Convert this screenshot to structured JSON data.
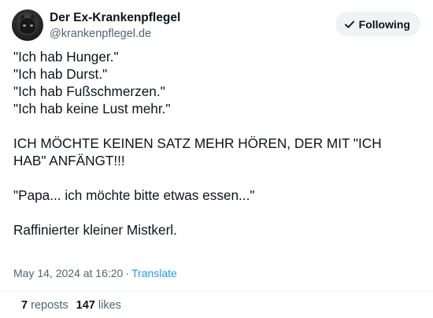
{
  "author": {
    "display_name": "Der Ex-Krankenpflegel",
    "handle": "@krankenpflegel.de"
  },
  "follow_button": {
    "label": "Following"
  },
  "post": {
    "text": "\"Ich hab Hunger.\"\n\"Ich hab Durst.\"\n\"Ich hab Fußschmerzen.\"\n\"Ich hab keine Lust mehr.\"\n\nICH MÖCHTE KEINEN SATZ MEHR HÖREN, DER MIT \"ICH HAB\" ANFÄNGT!!!\n\n\"Papa... ich möchte bitte etwas essen...\"\n\nRaffinierter kleiner Mistkerl.",
    "timestamp": "May 14, 2024 at 16:20",
    "separator": "·",
    "translate_label": "Translate"
  },
  "stats": {
    "reposts_count": "7",
    "reposts_label": "reposts",
    "likes_count": "147",
    "likes_label": "likes"
  },
  "icons": {
    "avatar": "cat-avatar",
    "follow": "checkmark-icon"
  },
  "colors": {
    "text_primary": "#0f1419",
    "text_secondary": "#536471",
    "link": "#1d9bf0",
    "button_bg": "#eff3f4"
  }
}
